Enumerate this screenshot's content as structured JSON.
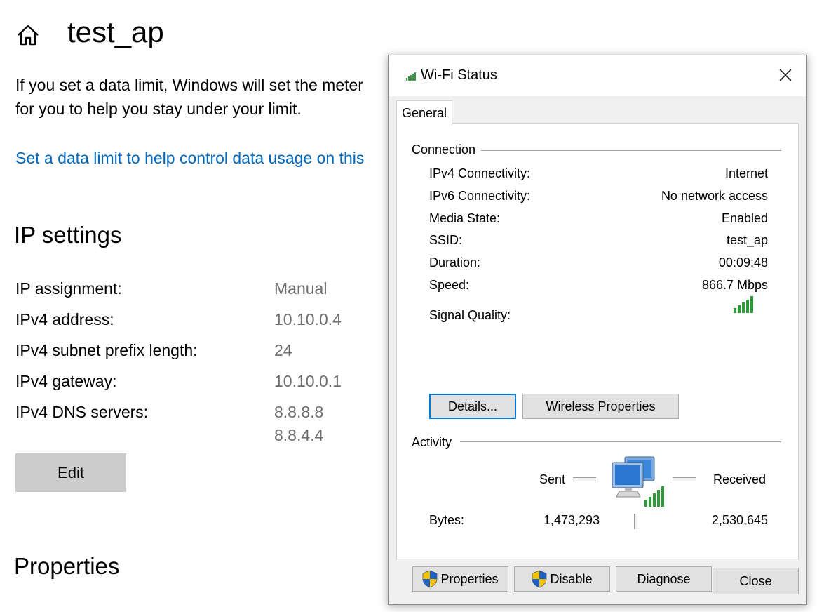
{
  "settings": {
    "title": "test_ap",
    "description_line1": "If you set a data limit, Windows will set the meter",
    "description_line2": "for you to help you stay under your limit.",
    "data_limit_link": "Set a data limit to help control data usage on this",
    "ip_heading": "IP settings",
    "ip_rows": [
      {
        "label": "IP assignment:",
        "value": "Manual"
      },
      {
        "label": "IPv4 address:",
        "value": "10.10.0.4"
      },
      {
        "label": "IPv4 subnet prefix length:",
        "value": "24"
      },
      {
        "label": "IPv4 gateway:",
        "value": "10.10.0.1"
      },
      {
        "label": "IPv4 DNS servers:",
        "value": "8.8.8.8",
        "value2": "8.8.4.4"
      }
    ],
    "edit_label": "Edit",
    "properties_heading": "Properties"
  },
  "dialog": {
    "title": "Wi-Fi Status",
    "tab": "General",
    "connection": {
      "heading": "Connection",
      "rows": [
        {
          "label": "IPv4 Connectivity:",
          "value": "Internet"
        },
        {
          "label": "IPv6 Connectivity:",
          "value": "No network access"
        },
        {
          "label": "Media State:",
          "value": "Enabled"
        },
        {
          "label": "SSID:",
          "value": "test_ap"
        },
        {
          "label": "Duration:",
          "value": "00:09:48"
        },
        {
          "label": "Speed:",
          "value": "866.7 Mbps"
        }
      ],
      "signal_label": "Signal Quality:",
      "signal_bars": 5,
      "details_button": "Details...",
      "wireless_button": "Wireless Properties"
    },
    "activity": {
      "heading": "Activity",
      "sent_label": "Sent",
      "received_label": "Received",
      "bytes_label": "Bytes:",
      "bytes_sent": "1,473,293",
      "bytes_received": "2,530,645"
    },
    "buttons": {
      "properties": "Properties",
      "disable": "Disable",
      "diagnose": "Diagnose",
      "close": "Close"
    }
  },
  "colors": {
    "link": "#0067c0",
    "signal_green": "#2e9b3a",
    "accent": "#0078d7"
  }
}
